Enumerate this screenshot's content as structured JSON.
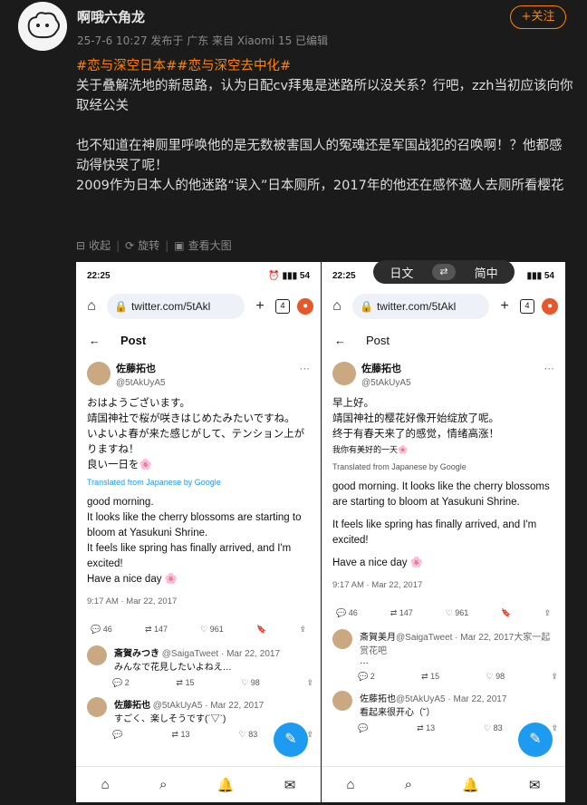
{
  "author": {
    "name": "啊哦六角龙",
    "meta": "25-7-6 10:27 发布于 广东 来自 Xiaomi 15 已编辑",
    "follow": "+关注"
  },
  "content": {
    "tags": "#恋与深空日本##恋与深空去中化#",
    "p1": "关于叠解洗地的新思路，认为日配cv拜鬼是迷路所以没关系？行吧，zzh当初应该向你取经公关",
    "p2": "也不知道在神厕里呼唤他的是无数被害国人的冤魂还是军国战犯的召唤啊！？他都感动得快哭了呢！",
    "p3": "2009作为日本人的他迷路“误入”日本厕所，2017年的他还在感怀邀人去厕所看樱花"
  },
  "actions": {
    "collect": "收起",
    "rotate": "旋转",
    "view": "查看大图"
  },
  "translate": {
    "from": "日文",
    "to": "简中",
    "swap": "⇄"
  },
  "phone1": {
    "time": "22:25",
    "url": "twitter.com/5tAkl",
    "tabs": "4",
    "header": "Post",
    "name": "佐藤拓也",
    "handle": "@5tAkUyA5",
    "jp": [
      "おはようございます。",
      "靖国神社で桜が咲きはじめたみたいですね。",
      "いよいよ春が来た感じがして、テンション上がりますね！",
      "良い一日を🌸"
    ],
    "translated": "Translated from Japanese by Google",
    "en": [
      "good morning.",
      "It looks like the cherry blossoms are starting to bloom at Yasukuni Shrine.",
      "It feels like spring has finally arrived, and I'm excited!",
      "Have a nice day 🌸"
    ],
    "time_stamp": "9:17 AM · Mar 22, 2017",
    "stats": {
      "reply": "46",
      "rt": "147",
      "like": "961"
    },
    "r1": {
      "name": "斎賀みつき",
      "handle": "@SaigaTweet · Mar 22, 2017",
      "text": "みんなで花見したいよねえ…",
      "reply": "2",
      "rt": "15",
      "like": "98"
    },
    "r2": {
      "name": "佐藤拓也",
      "handle": "@5tAkUyA5 · Mar 22, 2017",
      "text": "すごく、楽しそうです(´▽`)",
      "reply": "",
      "rt": "13",
      "like": "83"
    }
  },
  "phone2": {
    "time": "22:25",
    "url": "twitter.com/5tAkl",
    "tabs": "4",
    "header": "Post",
    "name": "佐藤拓也",
    "handle": "@5tAkUyA5",
    "zh": [
      "早上好。",
      "靖国神社的樱花好像开始绽放了呢。",
      "终于有春天来了的感觉，情绪高涨！",
      "我你有美好的一天🌸"
    ],
    "translated": "Translated from Japanese by Google",
    "en": [
      "good morning. It looks like the cherry blossoms are starting to bloom at Yasukuni Shrine.",
      "It feels like spring has finally arrived, and I'm excited!",
      "Have a nice day 🌸"
    ],
    "time_stamp": "9:17 AM · Mar 22, 2017",
    "stats": {
      "reply": "46",
      "rt": "147",
      "like": "961"
    },
    "r1": {
      "name": "斎賀美月",
      "handle": "@SaigaTweet · Mar 22, 2017大家一起赏花吧",
      "text": "…",
      "reply": "2",
      "rt": "15",
      "like": "98"
    },
    "r2": {
      "name": "佐藤拓也",
      "handle": "@5tAkUyA5 · Mar 22, 2017",
      "text": "看起来很开心（˘）",
      "reply": "",
      "rt": "13",
      "like": "83"
    }
  }
}
